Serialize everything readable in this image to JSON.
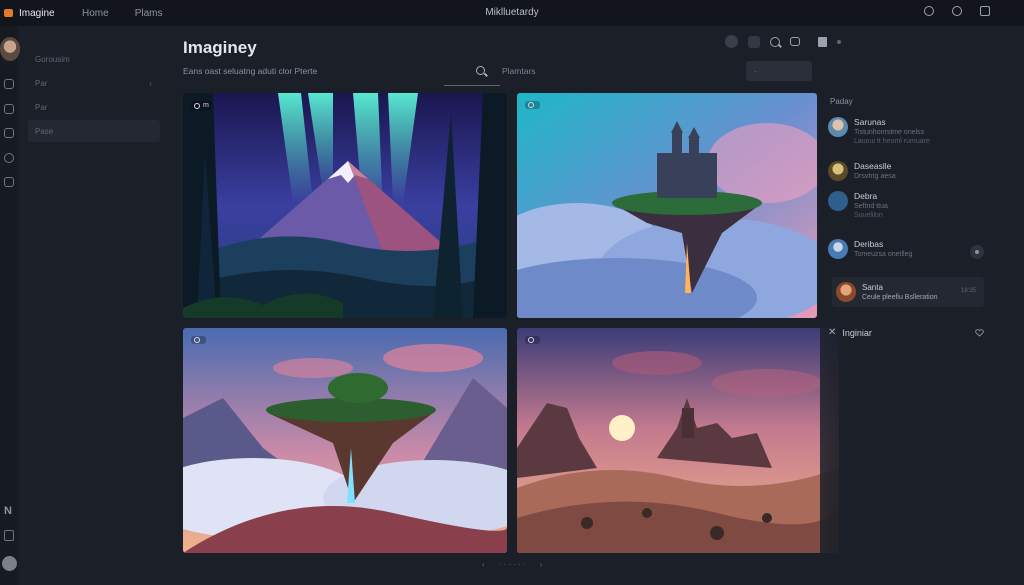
{
  "app": {
    "brand": "Imagine",
    "nav": [
      "Home",
      "Plams"
    ],
    "window_title": "Miklluetardy"
  },
  "leftnav": {
    "items": [
      {
        "label": "Gurousim",
        "active": false,
        "chevron": false
      },
      {
        "label": "Par",
        "active": false,
        "chevron": true
      },
      {
        "label": "Par",
        "active": false,
        "chevron": false
      },
      {
        "label": "Pase",
        "active": true,
        "chevron": false
      }
    ]
  },
  "header": {
    "title": "Imaginey",
    "subtitle": "Eans oast seluatng aduti clor Pterte",
    "search_tab": "Plamtars",
    "filter_box": "·"
  },
  "grid": {
    "cards": [
      {
        "badge": "m",
        "scene": "aurora-mountain-forest"
      },
      {
        "badge": "",
        "scene": "floating-castle-clouds"
      },
      {
        "badge": "",
        "scene": "floating-island-sunset"
      },
      {
        "badge": "",
        "scene": "desert-ruins-sunset"
      }
    ]
  },
  "panel": {
    "heading": "Paday",
    "chats": [
      {
        "name": "Sarunas",
        "line1": "Tistunhonrstme onelss",
        "line2": "Lauoui tt heoml rumuare",
        "avatar_color": "#5b8bb0"
      },
      {
        "name": "Daseaslle",
        "line1": "Drsvtrtg aesa",
        "line2": "",
        "avatar_color": "#8a7a4a"
      },
      {
        "name": "Debra",
        "line1": "Seftnd ttua",
        "line2": "Suuelilon",
        "avatar_color": "#2f5f8a"
      },
      {
        "name": "Deribas",
        "line1": "Tomeuzsa onetlleg",
        "line2": "",
        "avatar_color": "#4a7ab3"
      }
    ],
    "featured": {
      "name": "Santa",
      "message": "Ceule pleefiu Bslleration",
      "time": "18:35"
    },
    "section_title": "Inginiar"
  },
  "pager": {
    "prev": "‹",
    "label": "· · · · · ·",
    "next": "›"
  },
  "colors": {
    "background": "#1b1f27",
    "topbar": "#12151b",
    "accent": "#e07b2a"
  }
}
